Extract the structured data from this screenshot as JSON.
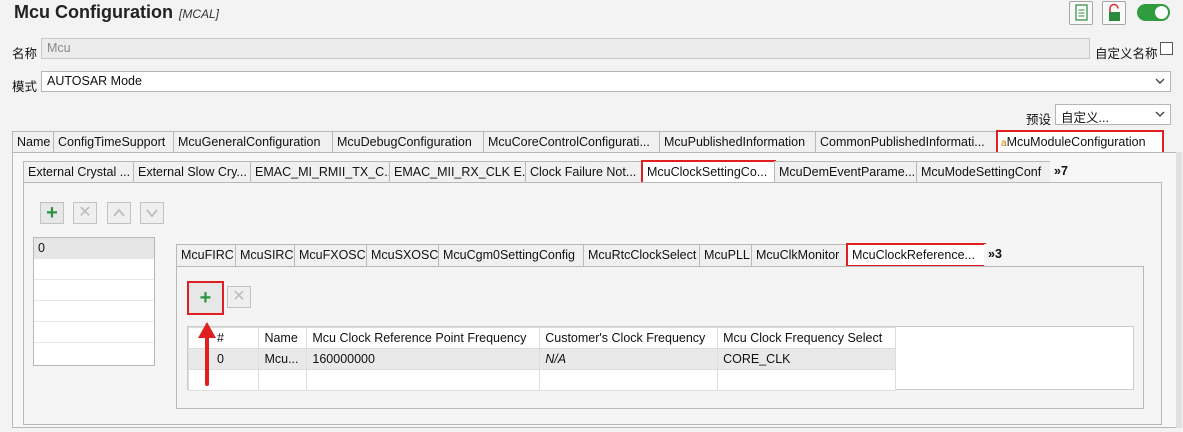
{
  "header": {
    "title": "Mcu Configuration",
    "subtitle": "[MCAL]"
  },
  "name_row": {
    "label": "名称",
    "value": "Mcu",
    "custom_name_label": "自定义名称",
    "custom_name_checked": false
  },
  "mode_row": {
    "label": "模式",
    "value": "AUTOSAR Mode"
  },
  "preset_row": {
    "label": "预设",
    "value": "自定义..."
  },
  "main_tabs": [
    "Name",
    "ConfigTimeSupport",
    "McuGeneralConfiguration",
    "McuDebugConfiguration",
    "McuCoreControlConfigurati...",
    "McuPublishedInformation",
    "CommonPublishedInformati...",
    "McuModuleConfiguration"
  ],
  "sub_tabs": [
    "External Crystal ...",
    "External Slow Cry...",
    "EMAC_MI_RMII_TX_C...",
    "EMAC_MII_RX_CLK E...",
    "Clock Failure Not...",
    "McuClockSettingCo...",
    "McuDemEventParame...",
    "McuModeSettingConf"
  ],
  "sub_tabs_overflow": "»7",
  "left_list": {
    "items": [
      "0"
    ]
  },
  "inner_tabs": [
    "McuFIRC",
    "McuSIRC",
    "McuFXOSC",
    "McuSXOSC",
    "McuCgm0SettingConfig",
    "McuRtcClockSelect",
    "McuPLL",
    "McuClkMonitor",
    "McuClockReference..."
  ],
  "inner_tabs_overflow": "»3",
  "table": {
    "columns": [
      "#",
      "Name",
      "Mcu Clock Reference Point Frequency",
      "Customer's Clock Frequency",
      "Mcu Clock Frequency Select"
    ],
    "rows": [
      [
        "0",
        "Mcu...",
        "160000000",
        "N/A",
        "CORE_CLK"
      ]
    ]
  },
  "colors": {
    "highlight": "#e02020",
    "toggle_on": "#2e9c3f",
    "add_green": "#2b9444"
  }
}
